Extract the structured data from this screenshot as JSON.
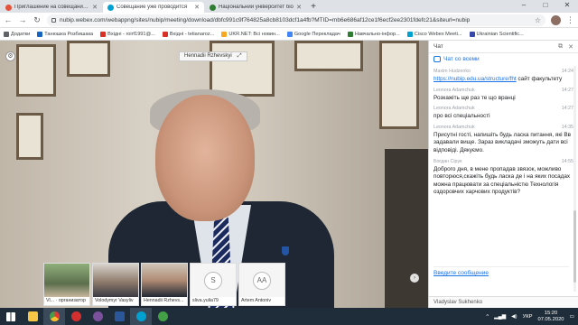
{
  "browser": {
    "tabs": [
      {
        "title": "Приглашение на совещание: Ha",
        "active": false,
        "favicon_color": "#e5533d"
      },
      {
        "title": "Совещание уже проводится",
        "active": true,
        "favicon_color": "#00a0d1"
      },
      {
        "title": "Національний університет біо",
        "active": false,
        "favicon_color": "#2e7d32"
      }
    ],
    "new_tab_label": "+",
    "window_controls": [
      "–",
      "□",
      "✕"
    ],
    "url": "nubip.webex.com/webappng/sites/nubip/meeting/download/dbfc991c9f764825a8cb8103dcf1a4fb?MTID=mb6e686af12ce1f6ecf2ee2301fdefc21&siteurl=nubip",
    "bookmarks": [
      {
        "label": "Додатки",
        "color": "#5f6368"
      },
      {
        "label": "Танюшка Розбишака",
        "color": "#1565c0"
      },
      {
        "label": "Вхідні - roirf1991@...",
        "color": "#d93025"
      },
      {
        "label": "Вхідні - tetianaroz...",
        "color": "#d93025"
      },
      {
        "label": "UKR.NET: Всі новин...",
        "color": "#f9a825"
      },
      {
        "label": "Google Перекладач",
        "color": "#4285f4"
      },
      {
        "label": "Навчально-інфор...",
        "color": "#2e7d32"
      },
      {
        "label": "Cisco Webex Meeti...",
        "color": "#00a0d1"
      },
      {
        "label": "Ukrainian Scientific...",
        "color": "#3949ab"
      }
    ]
  },
  "meeting": {
    "active_speaker": "Hennadii Rzhevskyi",
    "participants": [
      {
        "name": "Vl... · организатор",
        "initials": "",
        "video": true
      },
      {
        "name": "Volodymyr Vasyliv",
        "initials": "",
        "video": true
      },
      {
        "name": "Hennadii Rzhevs...",
        "initials": "",
        "video": true
      },
      {
        "name": "sliva.yulia79",
        "initials": "S",
        "video": false
      },
      {
        "name": "Artem Antoniv",
        "initials": "AA",
        "video": false
      }
    ]
  },
  "chat": {
    "header": "Чат",
    "recipient": "Чат со всеми",
    "messages": [
      {
        "author": "Maxim Hudzenko",
        "time": "14:24",
        "link": "https://nubip.edu.ua/structure/fht",
        "text": " сайт факультету"
      },
      {
        "author": "Leonora Adamchuk",
        "time": "14:27",
        "link": "",
        "text": "Розкажіть ще раз те що вранці"
      },
      {
        "author": "Leonora Adamchuk",
        "time": "14:27",
        "link": "",
        "text": "про всі спеціальності"
      },
      {
        "author": "Leonora Adamchuk",
        "time": "14:35",
        "link": "",
        "text": "Присутні гості, напишіть будь ласка питання, які Вв задавали вище. Зараз викладачі зможуть дати всі відповіді. Дякуємо."
      },
      {
        "author": "Богдан Сірук",
        "time": "14:55",
        "link": "",
        "text": "Доброго дня, в мене пропадав звязок, можливо повторюся,скажіть будь ласка де і на яких посадах можна працювати за спеціальністю Технологія оздоровчих харчових продуктів?"
      }
    ],
    "input_placeholder": "Введите сообщение",
    "footer_name": "Vladyslav Sukhenko"
  },
  "taskbar": {
    "icons": [
      {
        "name": "start",
        "color": "#ffffff"
      },
      {
        "name": "explorer",
        "color": "#f6c744"
      },
      {
        "name": "chrome",
        "color": "#e53935"
      },
      {
        "name": "opera",
        "color": "#d32f2f"
      },
      {
        "name": "viber",
        "color": "#7b519d"
      },
      {
        "name": "word",
        "color": "#2b579a"
      },
      {
        "name": "webex",
        "color": "#00a0d1"
      },
      {
        "name": "app",
        "color": "#43a047"
      }
    ],
    "language": "УКР",
    "time": "15:20",
    "date": "07.05.2020"
  }
}
